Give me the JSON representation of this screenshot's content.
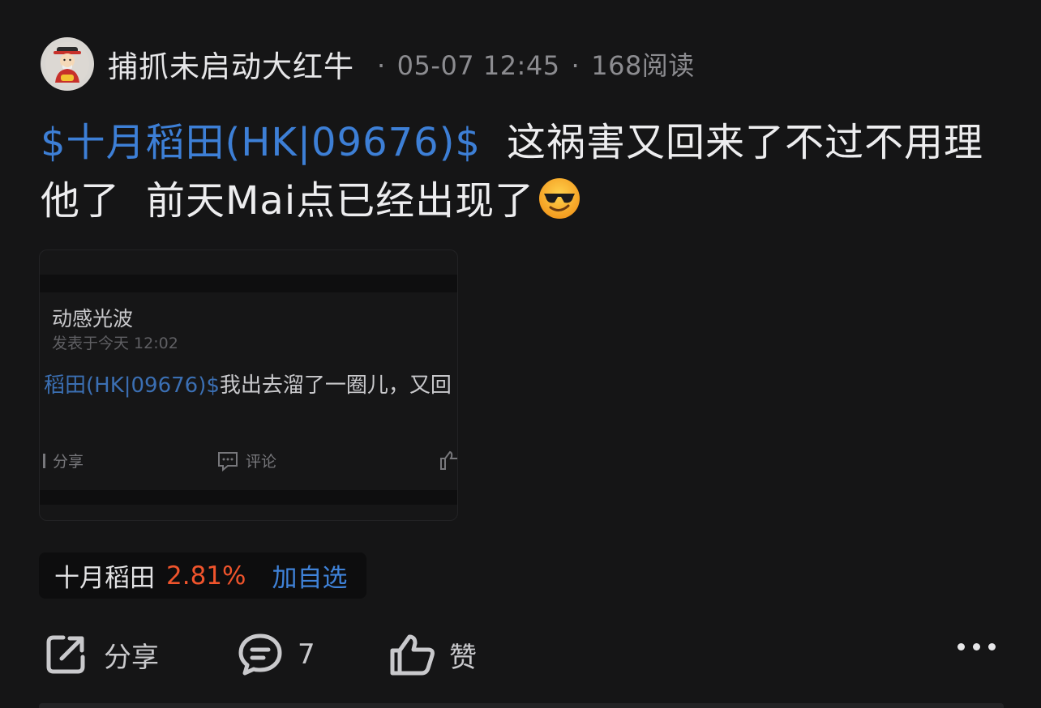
{
  "post": {
    "author": "捕抓未启动大红牛",
    "dot": "·",
    "date": "05-07 12:45",
    "reads": "168阅读",
    "stock_tag": "$十月稻田(HK|09676)$",
    "text_line1": "这祸害又回来了不过不用理",
    "text_line2_a": "他了",
    "text_line2_b": "前天Mai点已经出现了",
    "emoji": "smiling-face-with-sunglasses-emoji"
  },
  "embed": {
    "author": "动感光波",
    "time": "发表于今天 12:02",
    "link": "稻田(HK|09676)$",
    "text": "我出去溜了一圈儿，又回",
    "share": "分享",
    "comment": "评论"
  },
  "stock_chip": {
    "name": "十月稻田",
    "change": "2.81%",
    "add": "加自选",
    "change_color": "#f0542c"
  },
  "actions": {
    "share": "分享",
    "comment_count": "7",
    "like": "赞"
  },
  "colors": {
    "background": "#151516",
    "link": "#3d7fd6"
  }
}
